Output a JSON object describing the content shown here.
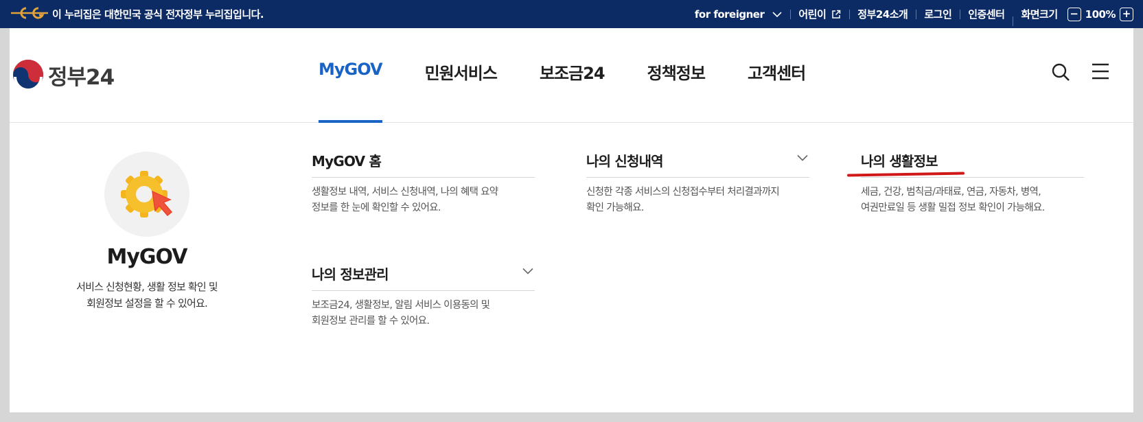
{
  "topbar": {
    "notice": "이 누리집은 대한민국 공식 전자정부 누리집입니다.",
    "util": {
      "foreigner": "for foreigner",
      "kids": "어린이",
      "about": "정부24소개",
      "login": "로그인",
      "cert": "인증센터",
      "zoom_label": "화면크기",
      "zoom_minus": "−",
      "zoom_value": "100%",
      "zoom_plus": "+"
    }
  },
  "header": {
    "logo_text": "정부24",
    "nav": [
      "MyGOV",
      "민원서비스",
      "보조금24",
      "정책정보",
      "고객센터"
    ],
    "active_nav": "MyGOV"
  },
  "intro": {
    "title": "MyGOV",
    "desc_line1": "서비스 신청현황, 생활 정보 확인 및",
    "desc_line2": "회원정보 설정을 할 수 있어요."
  },
  "menu": [
    {
      "title": "MyGOV 홈",
      "desc_line1": "생활정보 내역, 서비스 신청내역, 나의 혜택 요약",
      "desc_line2": "정보를 한 눈에 확인할 수 있어요."
    },
    {
      "title": "나의 신청내역",
      "desc_line1": "신청한 각종 서비스의 신청접수부터 처리결과까지",
      "desc_line2": "확인 가능해요."
    },
    {
      "title": "나의 생활정보",
      "desc_line1": "세금, 건강, 범칙금/과태료, 연금, 자동차, 병역,",
      "desc_line2": "여권만료일 등 생활 밀접 정보 확인이 가능해요."
    },
    {
      "title": "나의 정보관리",
      "desc_line1": "보조금24, 생활정보, 알림 서비스 이용동의 및",
      "desc_line2": "회원정보 관리를 할 수 있어요."
    }
  ],
  "colors": {
    "topbar_bg": "#0c2a63",
    "accent_blue": "#1a63c6",
    "highlight_red": "#d01818"
  }
}
